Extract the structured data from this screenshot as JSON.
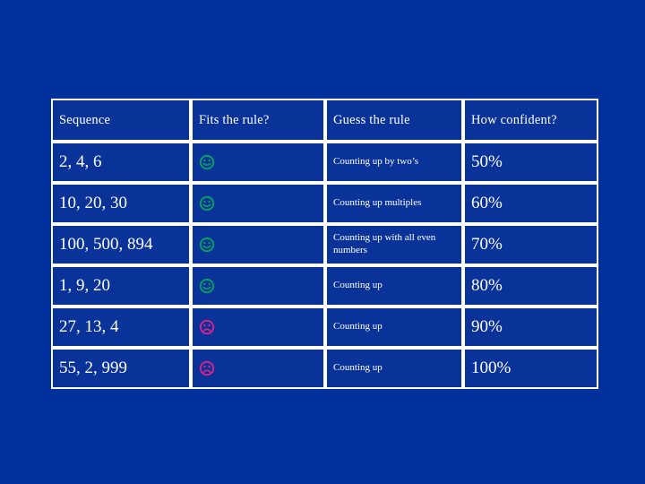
{
  "slide": {
    "background_color": "#00309c",
    "table_border_color": "#ffffff",
    "cell_background_color": "#0a3399",
    "text_color": "#ffffff",
    "happy_face_color": "#00a85a",
    "sad_face_color": "#e0218a"
  },
  "table": {
    "headers": [
      {
        "label": "Sequence"
      },
      {
        "label": "Fits the rule?"
      },
      {
        "label": "Guess the rule"
      },
      {
        "label": "How confident?"
      }
    ],
    "rows": [
      {
        "sequence": "2, 4, 6",
        "fits": "happy-face-icon",
        "guess": "Counting up by two’s",
        "confidence": "50%"
      },
      {
        "sequence": "10, 20, 30",
        "fits": "happy-face-icon",
        "guess": "Counting up multiples",
        "confidence": "60%"
      },
      {
        "sequence": "100, 500, 894",
        "fits": "happy-face-icon",
        "guess": "Counting up with all even numbers",
        "confidence": "70%"
      },
      {
        "sequence": "1, 9, 20",
        "fits": "happy-face-icon",
        "guess": "Counting up",
        "confidence": "80%"
      },
      {
        "sequence": "27, 13, 4",
        "fits": "sad-face-icon",
        "guess": "Counting up",
        "confidence": "90%"
      },
      {
        "sequence": "55, 2, 999",
        "fits": "sad-face-icon",
        "guess": "Counting up",
        "confidence": "100%"
      }
    ]
  }
}
